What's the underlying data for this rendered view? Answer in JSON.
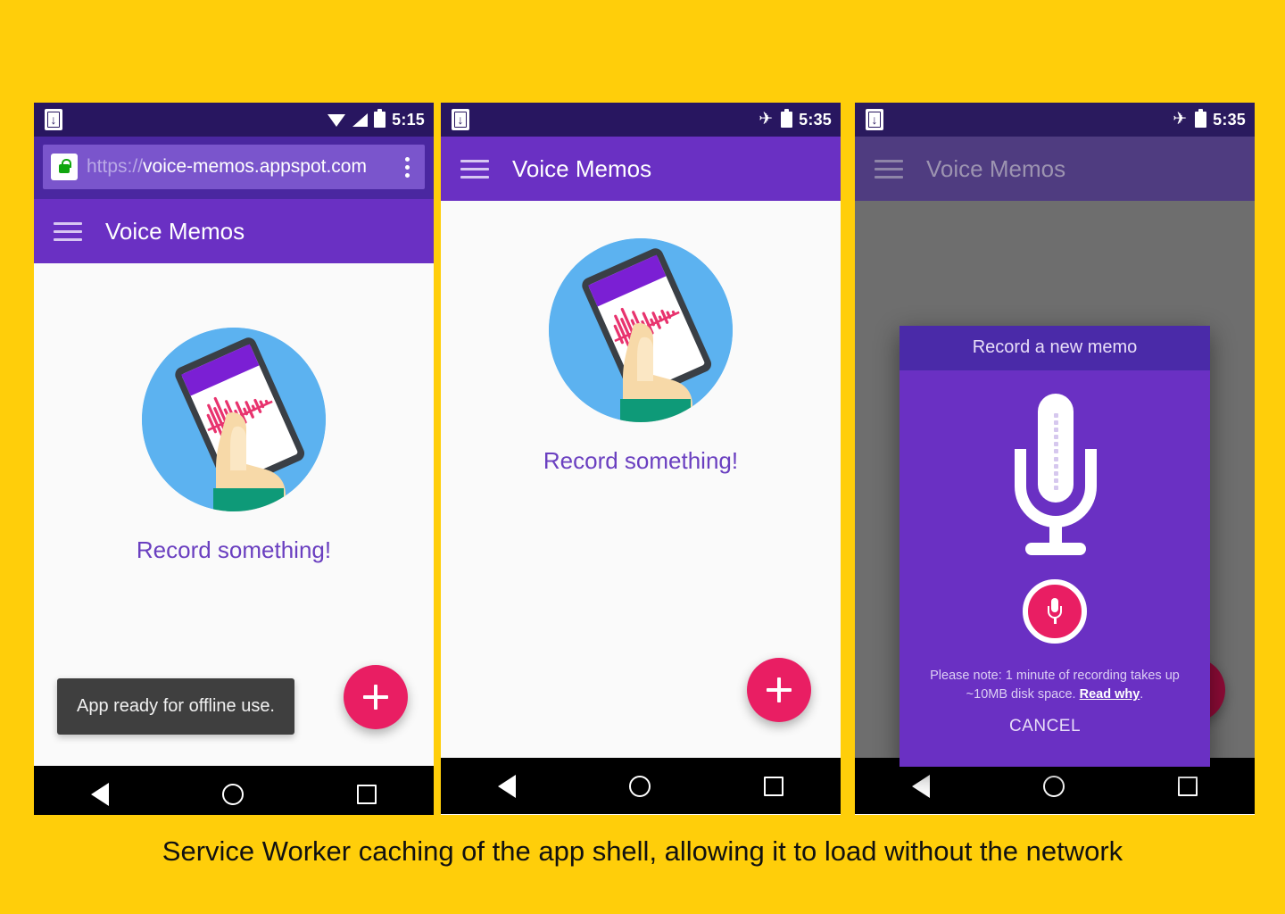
{
  "background_color": "#FFCE0A",
  "caption": "Service Worker caching of the app shell, allowing it to load without the network",
  "app": {
    "name": "Voice Memos",
    "accent_purple": "#6A30C3",
    "accent_pink": "#E91E63",
    "empty_state_label": "Record something!",
    "fab_label": "+"
  },
  "phones": [
    {
      "id": "phone-browser",
      "status_bar": {
        "download_icon": "download-icon",
        "wifi_icon": "wifi-icon",
        "signal_icon": "signal-icon",
        "battery_icon": "battery-icon",
        "time": "5:15"
      },
      "browser": {
        "lock_icon": "lock-icon",
        "url_scheme": "https://",
        "url_host": "voice-memos.appspot.com",
        "menu_icon": "kebab-menu-icon"
      },
      "appbar": {
        "menu_icon": "hamburger-icon",
        "title": "Voice Memos"
      },
      "empty_state_label": "Record something!",
      "toast": "App ready for offline use.",
      "fab_label": "+"
    },
    {
      "id": "phone-standalone",
      "status_bar": {
        "download_icon": "download-icon",
        "airplane_icon": "airplane-mode-icon",
        "battery_icon": "battery-icon",
        "time": "5:35"
      },
      "appbar": {
        "menu_icon": "hamburger-icon",
        "title": "Voice Memos"
      },
      "empty_state_label": "Record something!",
      "fab_label": "+"
    },
    {
      "id": "phone-dialog",
      "status_bar": {
        "download_icon": "download-icon",
        "airplane_icon": "airplane-mode-icon",
        "battery_icon": "battery-icon",
        "time": "5:35"
      },
      "appbar": {
        "menu_icon": "hamburger-icon",
        "title": "Voice Memos"
      },
      "dialog": {
        "title": "Record a new memo",
        "mic_icon": "microphone-icon",
        "record_button_icon": "record-microphone-icon",
        "note_text_before": "Please note: 1 minute of recording takes up ~10MB disk space. ",
        "note_link": "Read why",
        "note_text_after": ".",
        "cancel_label": "CANCEL"
      },
      "fab_label": "+"
    }
  ],
  "navbar": {
    "back_icon": "back-triangle-icon",
    "home_icon": "home-circle-icon",
    "recents_icon": "recents-square-icon"
  }
}
